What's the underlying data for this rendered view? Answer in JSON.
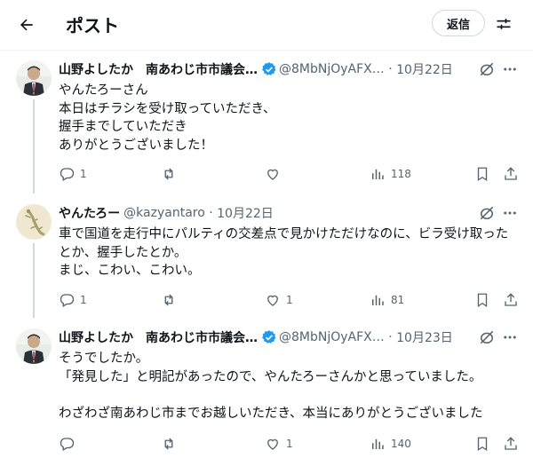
{
  "header": {
    "title": "ポスト",
    "reply_label": "返信"
  },
  "colors": {
    "verified": "#1d9bf0",
    "text": "#0f1419",
    "muted": "#536471"
  },
  "posts": [
    {
      "author": "山野よしたか　南あわじ市市議会…",
      "handle": "@8MbNjOyAFX…",
      "date": "10月22日",
      "verified": true,
      "text": "やんたろーさん\n本日はチラシを受け取っていただき、\n握手までしていただき\nありがとうございました！",
      "stats": {
        "replies": "1",
        "reposts": "",
        "likes": "",
        "views": "118"
      }
    },
    {
      "author": "やんたろー",
      "handle": "@kazyantaro",
      "date": "10月22日",
      "verified": false,
      "text": "車で国道を走行中にパルティの交差点で見かけただけなのに、ビラ受け取ったとか、握手したとか。\nまじ、こわい、こわい。",
      "stats": {
        "replies": "1",
        "reposts": "",
        "likes": "1",
        "views": "81"
      }
    },
    {
      "author": "山野よしたか　南あわじ市市議会…",
      "handle": "@8MbNjOyAFX…",
      "date": "10月23日",
      "verified": true,
      "text": "そうでしたか。\n「発見した」と明記があったので、やんたろーさんかと思っていました。\n\nわざわざ南あわじ市までお越しいただき、本当にありがとうございました",
      "stats": {
        "replies": "",
        "reposts": "",
        "likes": "1",
        "views": "140"
      }
    }
  ]
}
